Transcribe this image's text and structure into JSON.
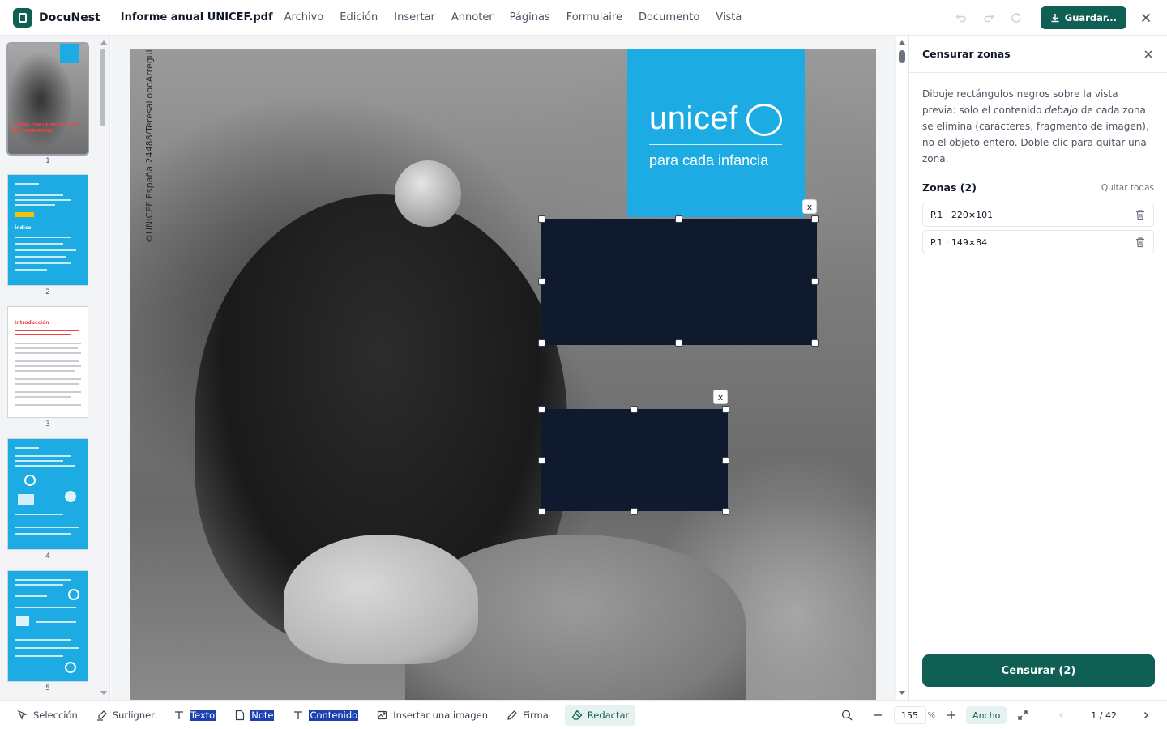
{
  "app": {
    "name": "DocuNest",
    "file_name": "Informe anual UNICEF.pdf"
  },
  "menu": [
    "Archivo",
    "Edición",
    "Insertar",
    "Annoter",
    "Páginas",
    "Formulaire",
    "Documento",
    "Vista"
  ],
  "toolbar": {
    "save_label": "Guardar..."
  },
  "thumbnails": [
    {
      "num": "1",
      "cover_text": "CONTAR CON LA INFANCIA ES UNA EMERGENCIA"
    },
    {
      "num": "2",
      "heading": "Índice"
    },
    {
      "num": "3",
      "heading": "Introducción"
    },
    {
      "num": "4"
    },
    {
      "num": "5"
    }
  ],
  "page": {
    "credit": "©UNICEF España 24488/TeresaLoboArregui",
    "brand": "unicef",
    "tagline": "para cada infancia"
  },
  "panel": {
    "title": "Censurar zonas",
    "desc_1": "Dibuje rectángulos negros sobre la vista previa: solo el contenido ",
    "desc_em": "debajo",
    "desc_2": " de cada zona se elimina (caracteres, fragmento de imagen), no el objeto entero. Doble clic para quitar una zona.",
    "zones_title": "Zonas (2)",
    "remove_all": "Quitar todas",
    "zones": [
      "P.1 · 220×101",
      "P.1 · 149×84"
    ],
    "censor_button": "Censurar (2)",
    "zone_remove_glyph": "x"
  },
  "bottom": {
    "tools": {
      "selection": "Selección",
      "highlight": "Surligner",
      "text": "Texto",
      "note": "Note",
      "content": "Contenido",
      "insert_image": "Insertar una imagen",
      "signature": "Firma",
      "redact": "Redactar"
    },
    "zoom_value": "155",
    "zoom_unit": "%",
    "fit_label": "Ancho",
    "page_indicator": "1 / 42"
  },
  "colors": {
    "accent": "#0f5f54",
    "redaction": "#0f1a2e",
    "unicef_blue": "#1cabe2"
  }
}
